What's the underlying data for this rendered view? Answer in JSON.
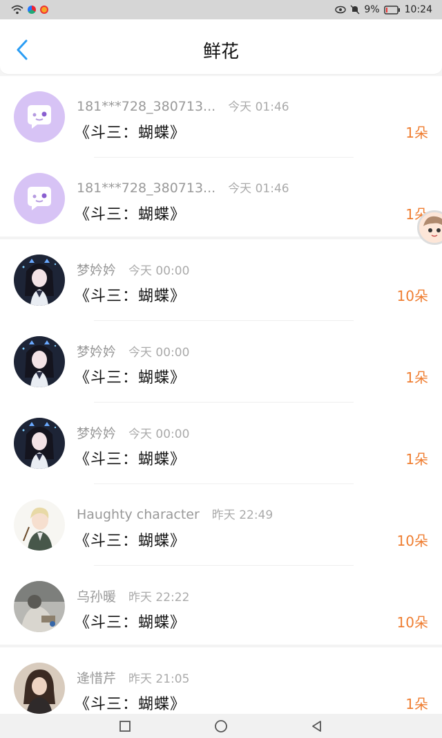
{
  "status_bar": {
    "battery_percent": "9%",
    "time": "10:24",
    "icons": [
      "wifi-icon",
      "app-badge-icon",
      "weibo-icon",
      "eye-icon",
      "mute-icon",
      "battery-icon"
    ]
  },
  "header": {
    "title": "鲜花",
    "back_icon": "chevron-left-icon"
  },
  "items": [
    {
      "name": "181***728_380713...",
      "time": "今天 01:46",
      "gift": "《斗三：蝴蝶》",
      "count": "1朵",
      "avatar": "chat-bubble-avatar"
    },
    {
      "name": "181***728_380713...",
      "time": "今天 01:46",
      "gift": "《斗三：蝴蝶》",
      "count": "1朵",
      "avatar": "chat-bubble-avatar"
    },
    {
      "name": "梦妗妗",
      "time": "今天 00:00",
      "gift": "《斗三：蝴蝶》",
      "count": "10朵",
      "avatar": "anime-girl-avatar"
    },
    {
      "name": "梦妗妗",
      "time": "今天 00:00",
      "gift": "《斗三：蝴蝶》",
      "count": "1朵",
      "avatar": "anime-girl-avatar"
    },
    {
      "name": "梦妗妗",
      "time": "今天 00:00",
      "gift": "《斗三：蝴蝶》",
      "count": "1朵",
      "avatar": "anime-girl-avatar"
    },
    {
      "name": "Haughty character",
      "time": "昨天 22:49",
      "gift": "《斗三：蝴蝶》",
      "count": "10朵",
      "avatar": "blonde-boy-avatar"
    },
    {
      "name": "乌孙暖",
      "time": "昨天 22:22",
      "gift": "《斗三：蝴蝶》",
      "count": "10朵",
      "avatar": "photo-avatar"
    },
    {
      "name": "逄惜芹",
      "time": "昨天 21:05",
      "gift": "《斗三：蝴蝶》",
      "count": "1朵",
      "avatar": "girl-photo-avatar"
    }
  ],
  "colors": {
    "accent_blue": "#2a9df4",
    "count_orange": "#ef7d30",
    "avatar_purple": "#d7c3f5"
  },
  "nav_bar": {
    "icons": [
      "recent-apps-icon",
      "home-icon",
      "back-icon"
    ]
  }
}
